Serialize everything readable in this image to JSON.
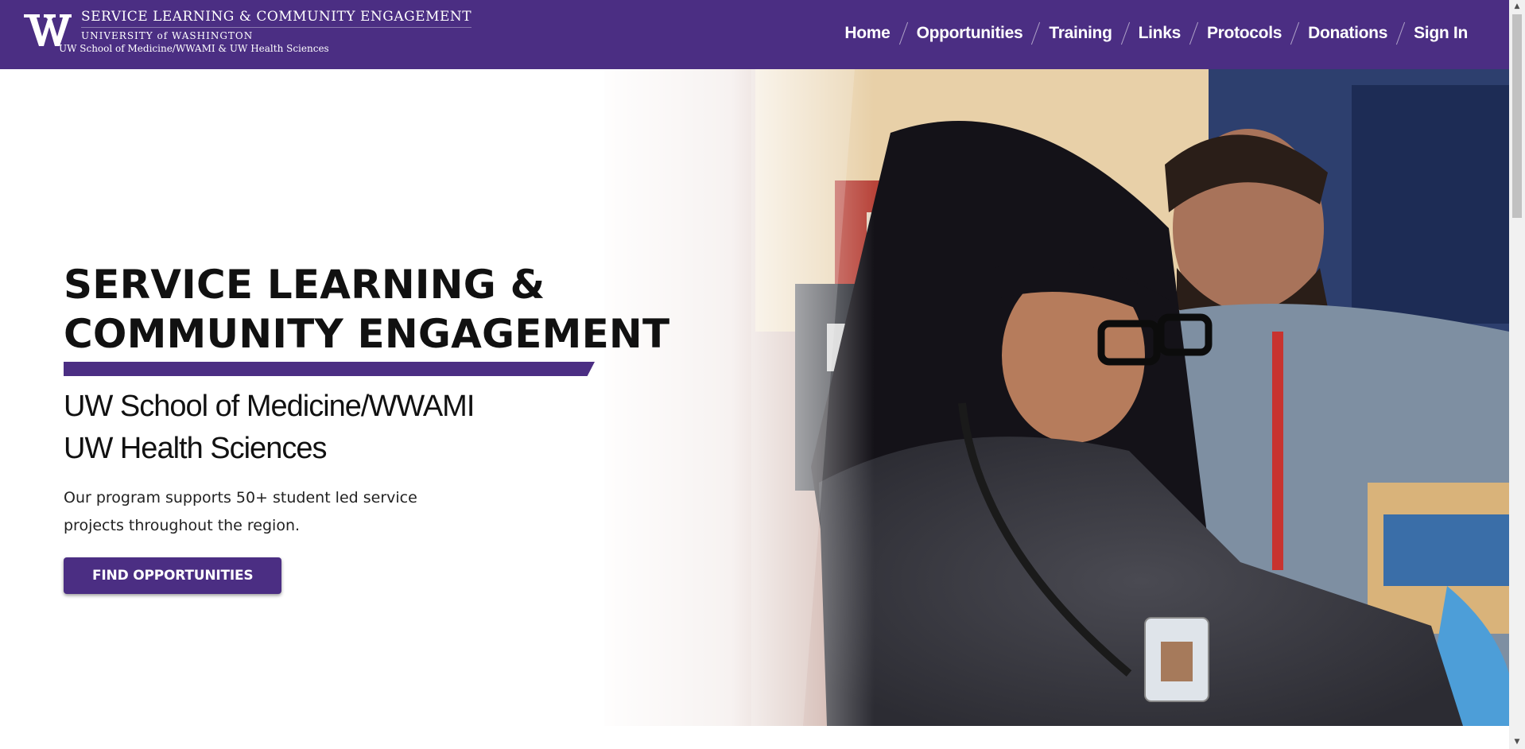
{
  "header": {
    "logo_letter": "W",
    "site_title": "SERVICE LEARNING & COMMUNITY ENGAGEMENT",
    "university": "UNIVERSITY of WASHINGTON",
    "subtitle": "UW School of Medicine/WWAMI & UW Health Sciences",
    "brand_color": "#4b2e83"
  },
  "nav": {
    "items": [
      {
        "label": "Home"
      },
      {
        "label": "Opportunities"
      },
      {
        "label": "Training"
      },
      {
        "label": "Links"
      },
      {
        "label": "Protocols"
      },
      {
        "label": "Donations"
      },
      {
        "label": "Sign In"
      }
    ]
  },
  "hero": {
    "title_line1": "SERVICE LEARNING &",
    "title_line2": "COMMUNITY ENGAGEMENT",
    "sub_line1": "UW School of Medicine/WWAMI",
    "sub_line2": "UW Health Sciences",
    "description": "Our program supports 50+ student led service projects throughout the region.",
    "cta_label": "FIND OPPORTUNITIES"
  },
  "scrollbar": {
    "up_icon": "chevron-up-icon",
    "down_icon": "chevron-down-icon"
  }
}
